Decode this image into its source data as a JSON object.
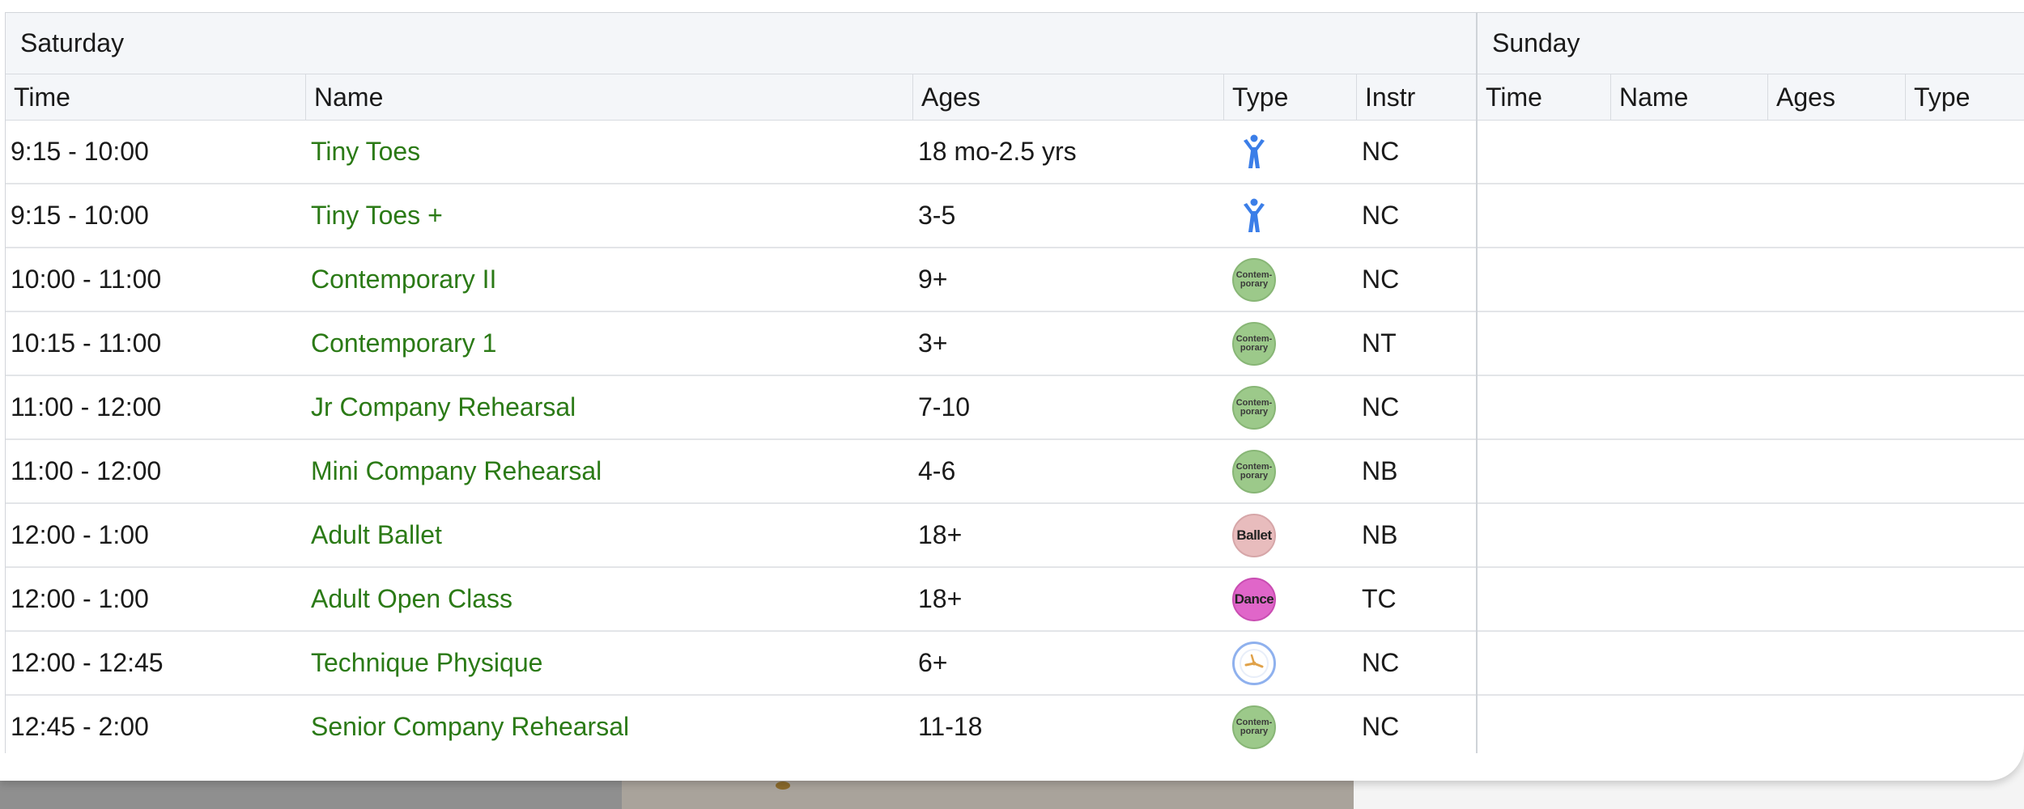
{
  "saturday": {
    "title": "Saturday",
    "headers": {
      "time": "Time",
      "name": "Name",
      "ages": "Ages",
      "type": "Type",
      "instr": "Instr"
    },
    "rows": [
      {
        "time": "9:15 - 10:00",
        "name": "Tiny Toes",
        "ages": "18 mo-2.5 yrs",
        "type": "person-icon",
        "instr": "NC"
      },
      {
        "time": "9:15 - 10:00",
        "name": "Tiny Toes +",
        "ages": "3-5",
        "type": "person-icon",
        "instr": "NC"
      },
      {
        "time": "10:00 - 11:00",
        "name": "Contemporary II",
        "ages": "9+",
        "type": "contemporary",
        "instr": "NC"
      },
      {
        "time": "10:15 - 11:00",
        "name": "Contemporary 1",
        "ages": "3+",
        "type": "contemporary",
        "instr": "NT"
      },
      {
        "time": "11:00 - 12:00",
        "name": "Jr Company Rehearsal",
        "ages": "7-10",
        "type": "contemporary",
        "instr": "NC"
      },
      {
        "time": "11:00 - 12:00",
        "name": "Mini Company Rehearsal",
        "ages": "4-6",
        "type": "contemporary",
        "instr": "NB"
      },
      {
        "time": "12:00 - 1:00",
        "name": "Adult Ballet",
        "ages": "18+",
        "type": "ballet",
        "instr": "NB"
      },
      {
        "time": "12:00 - 1:00",
        "name": "Adult Open Class",
        "ages": "18+",
        "type": "dance",
        "instr": "TC"
      },
      {
        "time": "12:00 - 12:45",
        "name": "Technique Physique",
        "ages": "6+",
        "type": "clock-icon",
        "instr": "NC"
      },
      {
        "time": "12:45 - 2:00",
        "name": "Senior Company Rehearsal",
        "ages": "11-18",
        "type": "contemporary",
        "instr": "NC"
      }
    ]
  },
  "sunday": {
    "title": "Sunday",
    "headers": {
      "time": "Time",
      "name": "Name",
      "ages": "Ages",
      "type": "Type"
    },
    "row_count": 10
  },
  "badges": {
    "contemporary_line1": "Contem-",
    "contemporary_line2": "porary",
    "ballet": "Ballet",
    "dance": "Dance"
  },
  "colors": {
    "class_name": "#2b7a16",
    "person_icon": "#3b7ee8",
    "contemporary_badge": "#9cc98a",
    "ballet_badge": "#e8bcbd",
    "dance_badge": "#e066c9",
    "clock_ring": "#8fb1ee",
    "clock_hand": "#e0a24a"
  }
}
